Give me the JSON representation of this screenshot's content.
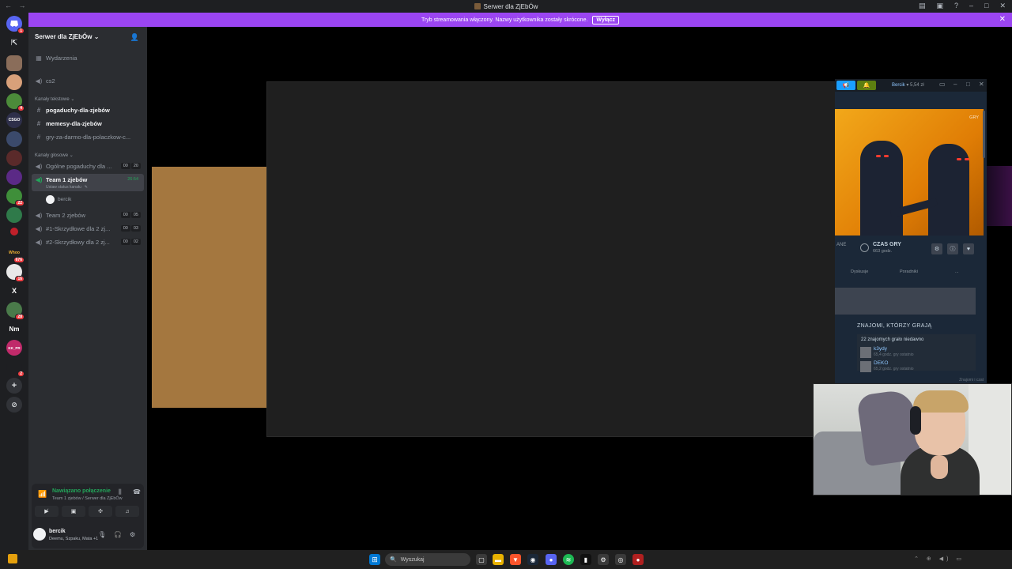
{
  "window": {
    "title": "Serwer dla ZjEbÓw"
  },
  "banner": {
    "text": "Tryb streamowania włączony. Nazwy użytkownika zostały skrócone.",
    "button": "Wyłącz"
  },
  "servers": [
    {
      "name": "direct-messages",
      "badge": "1"
    },
    {
      "name": "server-2",
      "badge": ""
    },
    {
      "name": "server-3",
      "badge": ""
    },
    {
      "name": "server-4",
      "badge": ""
    },
    {
      "name": "server-5",
      "badge": "4"
    },
    {
      "name": "server-6",
      "label": "CSGO\nSKINS",
      "badge": ""
    },
    {
      "name": "server-7",
      "badge": ""
    },
    {
      "name": "server-8",
      "badge": ""
    },
    {
      "name": "server-9",
      "badge": ""
    },
    {
      "name": "server-10",
      "badge": "22"
    },
    {
      "name": "server-11",
      "badge": ""
    },
    {
      "name": "server-12",
      "badge": ""
    },
    {
      "name": "server-13",
      "badge": "676"
    },
    {
      "name": "server-14",
      "badge": "16"
    },
    {
      "name": "server-15",
      "label": "X",
      "badge": ""
    },
    {
      "name": "server-16",
      "badge": "28"
    },
    {
      "name": "server-17",
      "label": "Nm",
      "badge": ""
    },
    {
      "name": "server-18",
      "label": "KK_PR",
      "badge": ""
    },
    {
      "name": "server-19",
      "badge": "2"
    }
  ],
  "guild": {
    "name": "Serwer dla ZjEbÓw",
    "events": "Wydarzenia",
    "forum": "cs2",
    "text_category": "Kanały tekstowe",
    "text_channels": [
      {
        "name": "pogaduchy-dla-zjebów"
      },
      {
        "name": "memesy-dla-zjebów"
      },
      {
        "name": "gry-za-darmo-dla-polaczkow-c..."
      }
    ],
    "voice_category": "Kanały głosowe",
    "voice_channels": [
      {
        "name": "Ogólne pogaduchy dla ...",
        "c1": "00",
        "c2": "20"
      },
      {
        "name": "Team 1 zjebów",
        "status": "Ustaw status kanału",
        "time": "26:54",
        "member": "bercik"
      },
      {
        "name": "Team 2 zjebów",
        "c1": "00",
        "c2": "05"
      },
      {
        "name": "#1-Skrzydłowe dla 2 zj...",
        "c1": "00",
        "c2": "03"
      },
      {
        "name": "#2-Skrzydłowy dla 2 zj...",
        "c1": "00",
        "c2": "02"
      }
    ]
  },
  "voice": {
    "status": "Nawiązano połączenie",
    "location": "Team 1 zjebów / Serwer dla ZjEbÓw"
  },
  "user": {
    "name": "bercik",
    "status": "Deemu, Szpaku, Mata +1"
  },
  "steam": {
    "account": "Bercik",
    "balance": "5,54 zł",
    "hero_tag": "GRY",
    "playtime_left": "ANE",
    "playtime_label": "CZAS GRY",
    "playtime_value": "663 godz.",
    "tabs": [
      "Dyskusje",
      "Poradniki",
      "..."
    ],
    "friends_title": "ZNAJOMI, KTÓRZY GRAJĄ",
    "friends_sub": "22 znajomych grało niedawno",
    "friends": [
      {
        "name": "k3ydy",
        "time": "65,4 godz. gry ostatnio"
      },
      {
        "name": "DEKO",
        "time": "65,2 godz. gry ostatnio"
      }
    ],
    "footer": "Znajomi i czat"
  },
  "taskbar": {
    "search": "Wyszukaj"
  },
  "colors": {
    "banner": "#9b45f2",
    "online": "#23a55a",
    "steam_bg": "#1b2838"
  }
}
